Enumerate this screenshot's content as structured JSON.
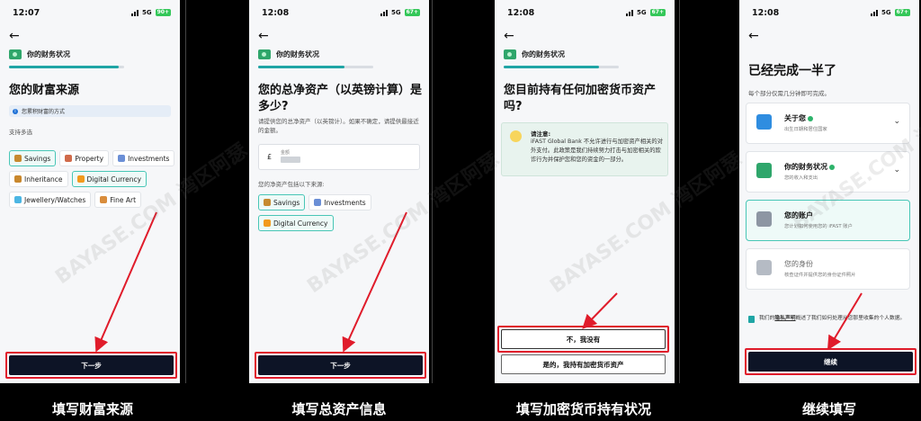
{
  "screens": [
    {
      "time": "12:07",
      "network": "5G",
      "battery": "90+",
      "section": "你的财务状况",
      "progress": 0.95,
      "title": "您的财富来源",
      "info": "您累积财富的方式",
      "hint": "支持多选",
      "chips": [
        {
          "label": "Savings",
          "icon": "money-bag-icon",
          "color": "#c78a2f",
          "selected": true
        },
        {
          "label": "Property",
          "icon": "house-icon",
          "color": "#d06a4a",
          "selected": false
        },
        {
          "label": "Investments",
          "icon": "chart-up-icon",
          "color": "#6b8fd6",
          "selected": false
        },
        {
          "label": "Inheritance",
          "icon": "person-icon",
          "color": "#c9882d",
          "selected": false
        },
        {
          "label": "Digital Currency",
          "icon": "bitcoin-icon",
          "color": "#f29a1d",
          "selected": true
        },
        {
          "label": "Jewellery/Watches",
          "icon": "gem-icon",
          "color": "#4cb6e3",
          "selected": false
        },
        {
          "label": "Fine Art",
          "icon": "palette-icon",
          "color": "#d98d3c",
          "selected": false
        }
      ],
      "button": "下一步",
      "caption": "填写财富来源"
    },
    {
      "time": "12:08",
      "network": "5G",
      "battery": "67+",
      "section": "你的财务状况",
      "progress": 0.75,
      "title": "您的总净资产（以英镑计算）是多少?",
      "desc": "请提供您的总净资产（以英镑计）。如果不确定，请提供最接近的金额。",
      "currency": "£",
      "field_label": "金额",
      "sources_label": "您的净资产包括以下来源:",
      "chips": [
        {
          "label": "Savings",
          "icon": "money-bag-icon",
          "color": "#c78a2f",
          "selected": true
        },
        {
          "label": "Investments",
          "icon": "chart-up-icon",
          "color": "#6b8fd6",
          "selected": false
        },
        {
          "label": "Digital Currency",
          "icon": "bitcoin-icon",
          "color": "#f29a1d",
          "selected": true
        }
      ],
      "button": "下一步",
      "caption": "填写总资产信息"
    },
    {
      "time": "12:08",
      "network": "5G",
      "battery": "67+",
      "section": "你的财务状况",
      "progress": 0.83,
      "title": "您目前持有任何加密货币资产吗?",
      "notice_title": "请注意:",
      "notice_body": "iFAST Global Bank 不允许进行与加密资产相关的对外支付。此政策是我们持续努力打击与加密相关的欺诈行为并保护您和您的资金的一部分。",
      "btn_no": "不，我没有",
      "btn_yes": "是的，我持有加密货币资产",
      "caption": "填写加密货币持有状况"
    },
    {
      "time": "12:08",
      "network": "5G",
      "battery": "67+",
      "title": "已经完成一半了",
      "subtitle": "每个部分仅需几分钟即可完成。",
      "cards": [
        {
          "title": "关于您",
          "sub": "出生日期和居住国家",
          "done": true,
          "chevron": true,
          "icon_color": "#2f8de0",
          "state": "done"
        },
        {
          "title": "你的财务状况",
          "sub": "您的收入和支出",
          "done": true,
          "chevron": true,
          "icon_color": "#2fa66b",
          "state": "done"
        },
        {
          "title": "您的账户",
          "sub": "您计划如何使用您的 iFAST 账户",
          "done": false,
          "chevron": false,
          "icon_color": "#8d96a3",
          "state": "active"
        },
        {
          "title": "您的身份",
          "sub": "核查证件并提供您的身份证件照片",
          "done": false,
          "chevron": false,
          "icon_color": "#b5bbc4",
          "state": "muted"
        }
      ],
      "privacy_pre": "我们的",
      "privacy_link": "隐私声明",
      "privacy_post": "概述了我们如何处理从您那里收集的个人数据。",
      "button": "继续",
      "caption": "继续填写"
    }
  ],
  "watermark": "BAYASE.COM 湾区阿瑟",
  "colors": {
    "accent": "#1fa5a5",
    "highlight": "#e01c2b",
    "primary_button": "#0d1426"
  }
}
